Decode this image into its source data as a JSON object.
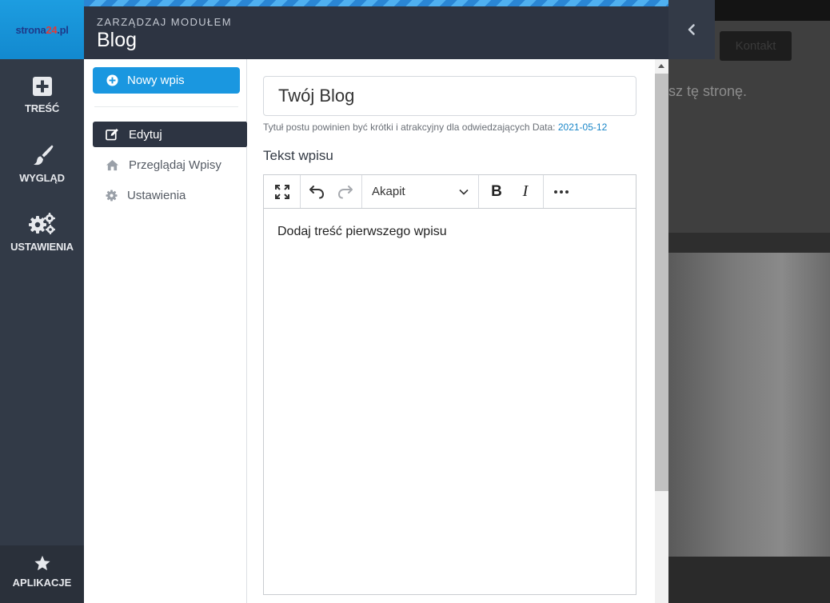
{
  "brand": {
    "logo_main": "strona",
    "logo_accent": "24",
    "logo_tld": ".pl"
  },
  "nav": {
    "items": [
      {
        "label": "TREŚĆ",
        "icon": "plus-square-icon"
      },
      {
        "label": "WYGLĄD",
        "icon": "brush-icon"
      },
      {
        "label": "USTAWIENIA",
        "icon": "gears-icon"
      }
    ],
    "apps_label": "APLIKACJE",
    "apps_icon": "star-icon"
  },
  "module": {
    "subtitle": "ZARZĄDZAJ MODUŁEM",
    "title": "Blog"
  },
  "sidebar": {
    "new_post_label": "Nowy wpis",
    "items": [
      {
        "label": "Edytuj",
        "icon": "edit-icon",
        "active": true
      },
      {
        "label": "Przeglądaj Wpisy",
        "icon": "home-icon",
        "active": false
      },
      {
        "label": "Ustawienia",
        "icon": "gear-icon",
        "active": false
      }
    ]
  },
  "post": {
    "title_value": "Twój Blog",
    "hint": "Tytuł postu powinien być krótki i atrakcyjny dla odwiedzających Data:",
    "date": "2021-05-12",
    "text_label": "Tekst wpisu",
    "body_text": "Dodaj treść pierwszego wpisu"
  },
  "toolbar": {
    "paragraph_label": "Akapit",
    "bold_label": "B",
    "italic_label": "I"
  },
  "background_site": {
    "button_label": "Kontakt",
    "text_fragment": "sz tę stronę."
  },
  "colors": {
    "accent": "#1a97e0",
    "dark": "#2d3442",
    "date_link": "#1a86c8"
  }
}
